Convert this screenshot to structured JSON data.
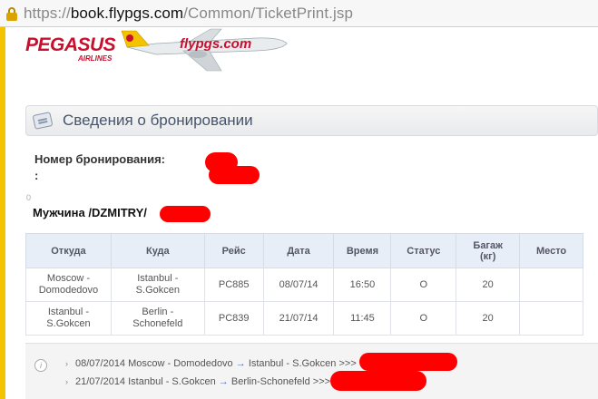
{
  "browser": {
    "url_scheme": "https://",
    "url_host": "book.flypgs.com",
    "url_path": "/Common/TicketPrint.jsp"
  },
  "header": {
    "logo_text": "PEGASUS",
    "logo_subtext": "AIRLINES",
    "plane_text": "flypgs.com"
  },
  "section": {
    "title": "Сведения о бронировании"
  },
  "booking": {
    "pnr_label": "Номер бронирования:",
    "pnr_colon": ":",
    "zero_mark": "0",
    "passenger": "Мужчина /DZMITRY/"
  },
  "table": {
    "headers": [
      "Откуда",
      "Куда",
      "Рейс",
      "Дата",
      "Время",
      "Статус",
      "Багаж (кг)",
      "Место"
    ],
    "rows": [
      {
        "from": "Moscow - Domodedovo",
        "to": "Istanbul - S.Gokcen",
        "flight": "PC885",
        "date": "08/07/14",
        "time": "16:50",
        "status": "O",
        "baggage": "20",
        "seat": ""
      },
      {
        "from": "Istanbul - S.Gokcen",
        "to": "Berlin - Schonefeld",
        "flight": "PC839",
        "date": "21/07/14",
        "time": "11:45",
        "status": "O",
        "baggage": "20",
        "seat": ""
      }
    ]
  },
  "routes": [
    {
      "date": "08/07/2014",
      "from": "Moscow - Domodedovo",
      "arrow": "→",
      "to": "Istanbul - S.Gokcen",
      "suffix": ">>>"
    },
    {
      "date": "21/07/2014",
      "from": "Istanbul - S.Gokcen",
      "arrow": "→",
      "to": "Berlin-Schonefeld",
      "suffix": ">>>"
    }
  ],
  "colors": {
    "brand_red": "#c8102e",
    "brand_yellow": "#f3c300",
    "redaction": "#ff0000"
  },
  "icons": {
    "lock": "lock-icon",
    "ticket": "ticket-icon",
    "info": "info-icon"
  }
}
